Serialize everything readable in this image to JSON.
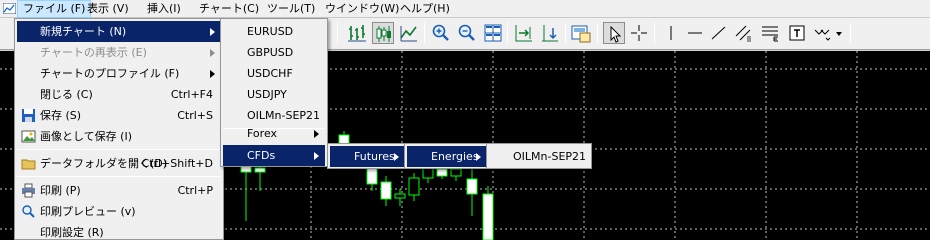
{
  "menubar": {
    "items": [
      {
        "label": "ファイル (F)"
      },
      {
        "label": "表示 (V)"
      },
      {
        "label": "挿入(I)"
      },
      {
        "label": "チャート(C)"
      },
      {
        "label": "ツール(T)"
      },
      {
        "label": "ウインドウ(W)"
      },
      {
        "label": "ヘルプ(H)"
      }
    ]
  },
  "file_menu": {
    "items": [
      {
        "label": "新規チャート (N)",
        "shortcut": "",
        "state": "highlighted",
        "submenu": true
      },
      {
        "label": "チャートの再表示 (E)",
        "shortcut": "",
        "state": "disabled",
        "submenu": true
      },
      {
        "label": "チャートのプロファイル (F)",
        "shortcut": "",
        "state": "normal",
        "submenu": true
      },
      {
        "label": "閉じる (C)",
        "shortcut": "Ctrl+F4",
        "state": "normal"
      },
      {
        "label": "保存 (S)",
        "shortcut": "Ctrl+S",
        "state": "normal",
        "icon": "save-icon"
      },
      {
        "label": "画像として保存 (I)",
        "shortcut": "",
        "state": "normal",
        "icon": "image-icon"
      },
      {
        "label": "データフォルダを開く(D)",
        "shortcut": "Ctrl+Shift+D",
        "state": "normal",
        "icon": "folder-icon"
      },
      {
        "label": "印刷 (P)",
        "shortcut": "Ctrl+P",
        "state": "normal",
        "icon": "print-icon"
      },
      {
        "label": "印刷プレビュー (v)",
        "shortcut": "",
        "state": "normal",
        "icon": "print-preview-icon"
      },
      {
        "label": "印刷設定 (R)",
        "shortcut": "",
        "state": "normal"
      }
    ]
  },
  "new_chart_menu": {
    "items": [
      {
        "label": "EURUSD"
      },
      {
        "label": "GBPUSD"
      },
      {
        "label": "USDCHF"
      },
      {
        "label": "USDJPY"
      },
      {
        "label": "OILMn-SEP21"
      },
      {
        "label": "Forex",
        "submenu": true
      },
      {
        "label": "CFDs",
        "submenu": true,
        "state": "highlighted"
      }
    ]
  },
  "cfds_menu": {
    "items": [
      {
        "label": "Futures",
        "submenu": true,
        "state": "highlighted"
      }
    ]
  },
  "futures_menu": {
    "items": [
      {
        "label": "Energies",
        "submenu": true,
        "state": "highlighted"
      }
    ]
  },
  "energies_menu": {
    "items": [
      {
        "label": "OILMn-SEP21"
      }
    ]
  },
  "colors": {
    "chart_background": "#000000",
    "candle_up": "#00ff00",
    "candle_down": "#ffffff",
    "grid": "#c0c0c0",
    "menu_highlight": "#0a246a"
  }
}
